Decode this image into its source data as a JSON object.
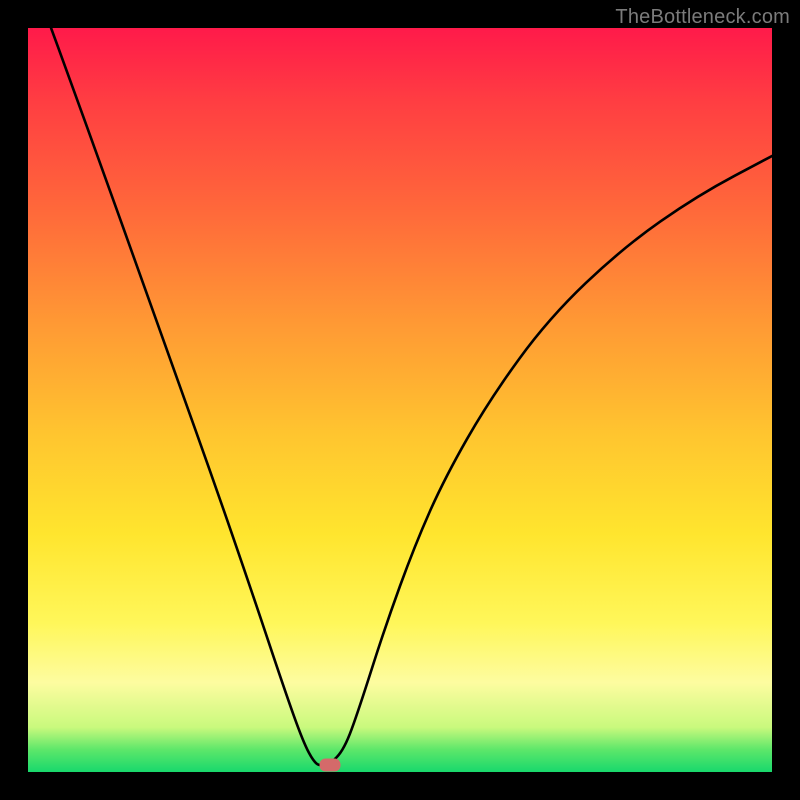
{
  "watermark": "TheBottleneck.com",
  "marker": {
    "x_frac": 0.4065,
    "y_frac": 0.99
  },
  "colors": {
    "curve": "#000000",
    "marker": "#d46a6a",
    "frame": "#000000"
  },
  "chart_data": {
    "type": "line",
    "title": "",
    "xlabel": "",
    "ylabel": "",
    "xlim": [
      0,
      1
    ],
    "ylim": [
      0,
      1
    ],
    "legend": false,
    "grid": false,
    "annotations": [
      "TheBottleneck.com"
    ],
    "background_gradient": [
      "#ff1a4a",
      "#ff9a34",
      "#ffe52e",
      "#18d86c"
    ],
    "series": [
      {
        "name": "curve",
        "x": [
          0.031,
          0.05,
          0.1,
          0.15,
          0.2,
          0.25,
          0.3,
          0.345,
          0.37,
          0.385,
          0.395,
          0.405,
          0.425,
          0.445,
          0.48,
          0.52,
          0.56,
          0.62,
          0.7,
          0.8,
          0.9,
          1.0
        ],
        "y": [
          1.0,
          0.948,
          0.81,
          0.67,
          0.53,
          0.39,
          0.245,
          0.11,
          0.04,
          0.012,
          0.008,
          0.01,
          0.03,
          0.085,
          0.195,
          0.305,
          0.395,
          0.5,
          0.61,
          0.705,
          0.775,
          0.828
        ]
      }
    ],
    "marker_point": {
      "x": 0.4065,
      "y": 0.01
    }
  }
}
